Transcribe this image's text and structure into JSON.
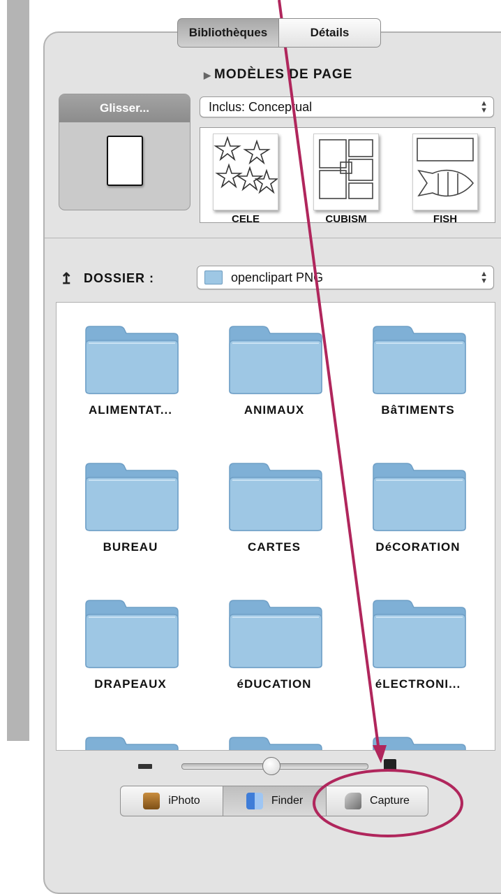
{
  "tabs": [
    {
      "label": "Bibliothèques",
      "active": true
    },
    {
      "label": "Détails",
      "active": false
    }
  ],
  "templates": {
    "section_title": "MODÈLES DE PAGE",
    "source_select": "Inclus: Conceptual",
    "drag_label": "Glisser...",
    "thumbnails": [
      {
        "label": "CELE"
      },
      {
        "label": "CUBISM"
      },
      {
        "label": "FISH"
      }
    ]
  },
  "folder_browser": {
    "label": "DOSSIER :",
    "current_folder": "openclipart PNG",
    "items": [
      {
        "name": "ALIMENTAT..."
      },
      {
        "name": "ANIMAUX"
      },
      {
        "name": "BâTIMENTS"
      },
      {
        "name": "BUREAU"
      },
      {
        "name": "CARTES"
      },
      {
        "name": "DéCORATION"
      },
      {
        "name": "DRAPEAUX"
      },
      {
        "name": "éDUCATION"
      },
      {
        "name": "éLECTRONI..."
      },
      {
        "name": ""
      },
      {
        "name": ""
      },
      {
        "name": ""
      }
    ]
  },
  "zoom": {
    "level": 0.48
  },
  "sources": [
    {
      "label": "iPhoto",
      "icon": "iphoto-icon",
      "active": false
    },
    {
      "label": "Finder",
      "icon": "finder-icon",
      "active": true
    },
    {
      "label": "Capture",
      "icon": "capture-icon",
      "active": false
    }
  ],
  "colors": {
    "annotation": "#b0265c",
    "folder": "#9ec7e4"
  }
}
